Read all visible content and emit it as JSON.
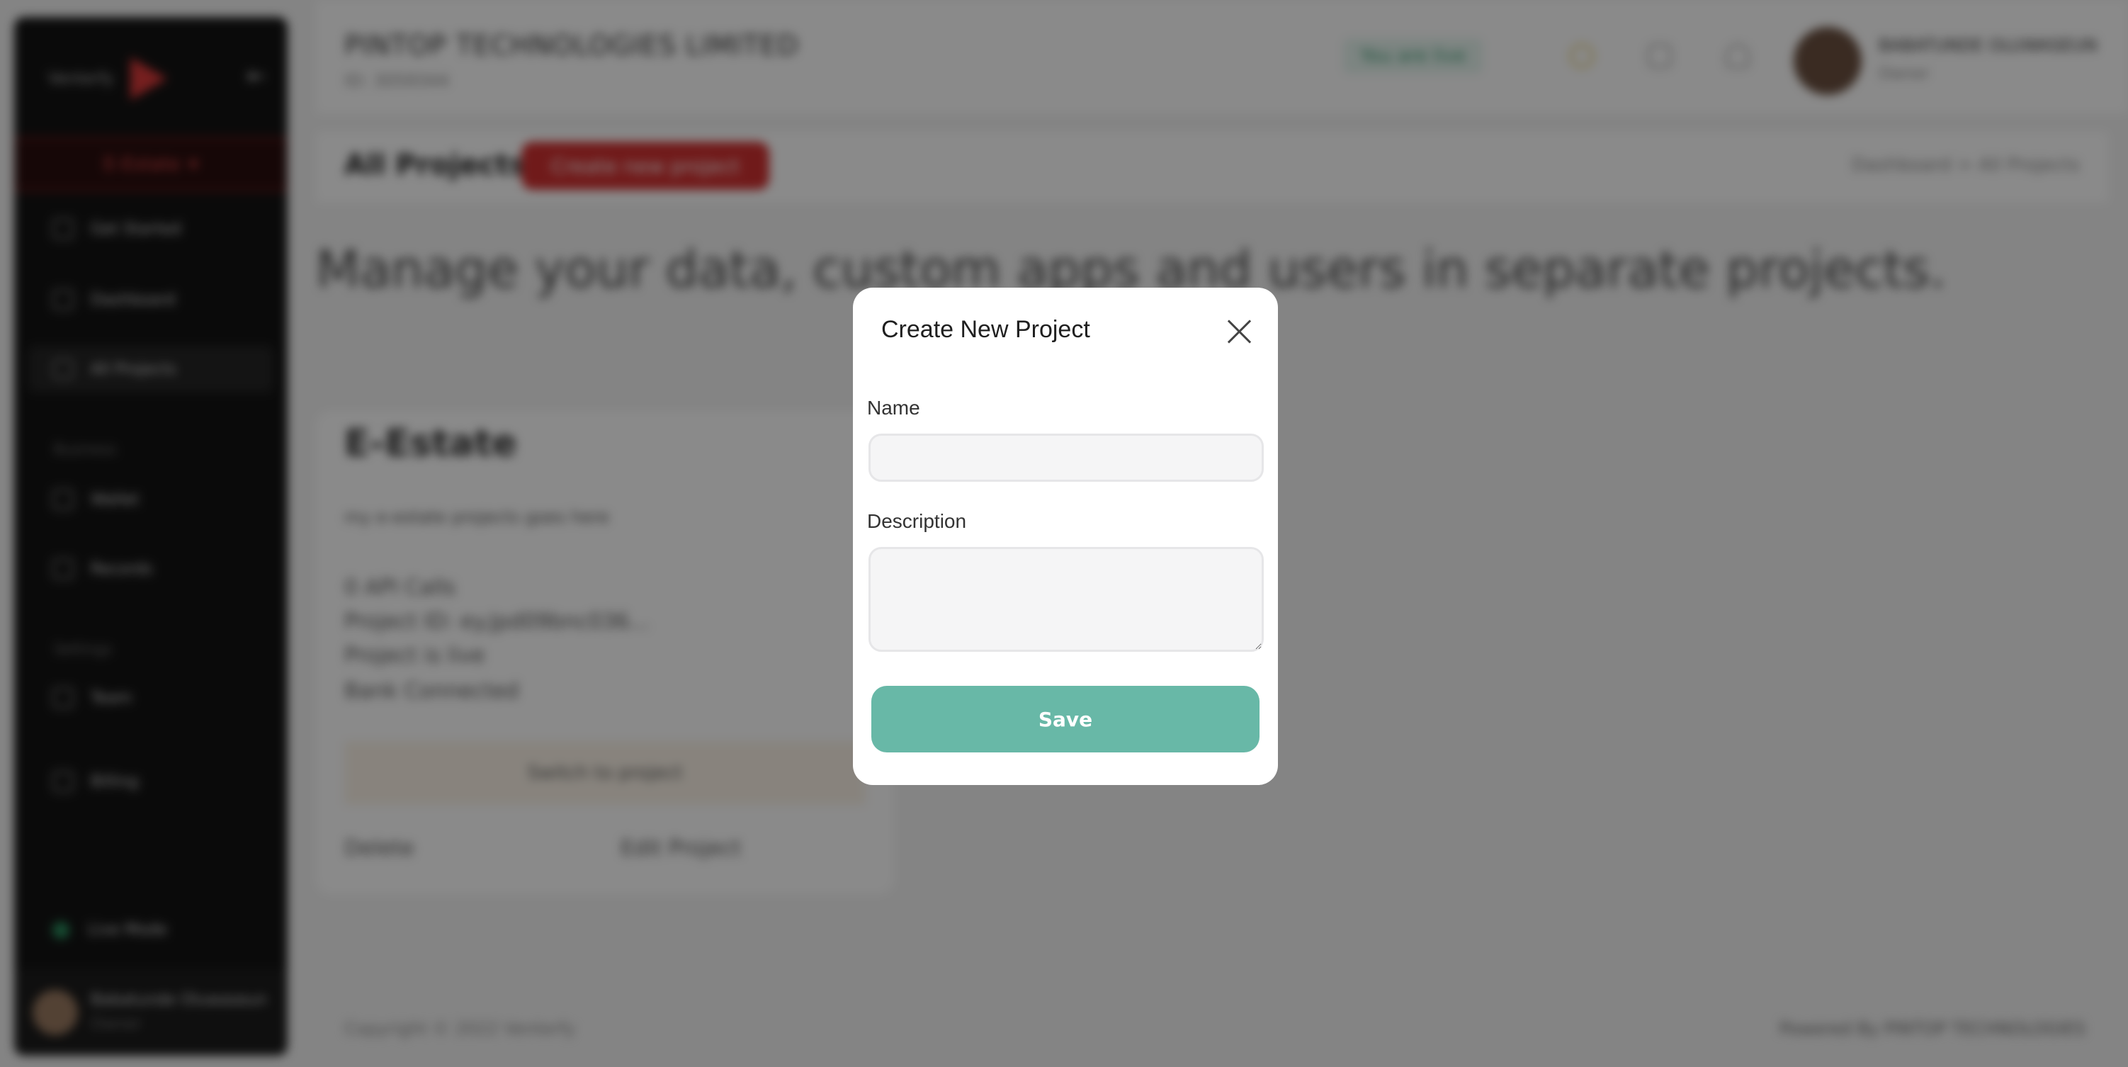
{
  "sidebar": {
    "logo_text": "Venterfy",
    "project_selector": "E-Estate",
    "nav": {
      "get_started": "Get Started",
      "dashboard": "Dashboard",
      "all_projects": "All Projects",
      "wallet": "Wallet",
      "records": "Records",
      "team": "Team",
      "billing": "Billing"
    },
    "section_business": "Business",
    "section_settings": "Settings",
    "live_mode": "Live Mode",
    "user_name": "Babatunde Oluwaseun",
    "user_role": "Owner"
  },
  "header": {
    "company": "PINTOP TECHNOLOGIES LIMITED",
    "company_id": "ID: 3059344",
    "live_badge": "You are live",
    "user_name": "BABATUNDE OLUWASEUN",
    "user_role": "Owner"
  },
  "page": {
    "title": "All Projects",
    "create_button": "Create new project",
    "breadcrumb": "Dashboard  >  All Projects",
    "lead": "Manage your data, custom apps and users in separate projects."
  },
  "project_card": {
    "name": "E-Estate",
    "description": "my e-estate projects goes here",
    "api_calls": "0 API Calls",
    "project_id": "Project ID: ey.Jpd09bnc036...",
    "status": "Project is live",
    "bank": "Bank Connected",
    "switch": "Switch to project",
    "delete": "Delete",
    "edit": "Edit Project"
  },
  "footer": {
    "copyright": "Copyright © 2022 Venterfy",
    "powered_by": "Powered By PINTOP TECHNOLOGIES"
  },
  "modal": {
    "title": "Create New Project",
    "name_label": "Name",
    "name_value": "",
    "description_label": "Description",
    "description_value": "",
    "save_label": "Save"
  },
  "colors": {
    "brand_red": "#d03131",
    "save_teal": "#68b8a7",
    "overlay": "rgba(0,0,0,0.46)"
  }
}
